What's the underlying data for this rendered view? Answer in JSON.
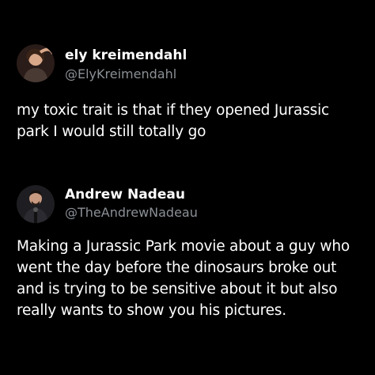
{
  "tweets": [
    {
      "author": {
        "name": "ely kreimendahl",
        "handle": "@ElyKreimendahl"
      },
      "text_lines": [
        "my toxic trait is that if they opened Jurassic",
        "park I would still totally go"
      ]
    },
    {
      "author": {
        "name": "Andrew Nadeau",
        "handle": "@TheAndrewNadeau"
      },
      "text_lines": [
        "Making a Jurassic Park movie about a guy who",
        "went the day before the dinosaurs broke out",
        "and is trying to be sensitive about it but also",
        "really wants to show you his pictures."
      ]
    }
  ],
  "colors": {
    "background": "#000000",
    "name": "#ffffff",
    "handle": "#8b9096",
    "body": "#ffffff"
  }
}
